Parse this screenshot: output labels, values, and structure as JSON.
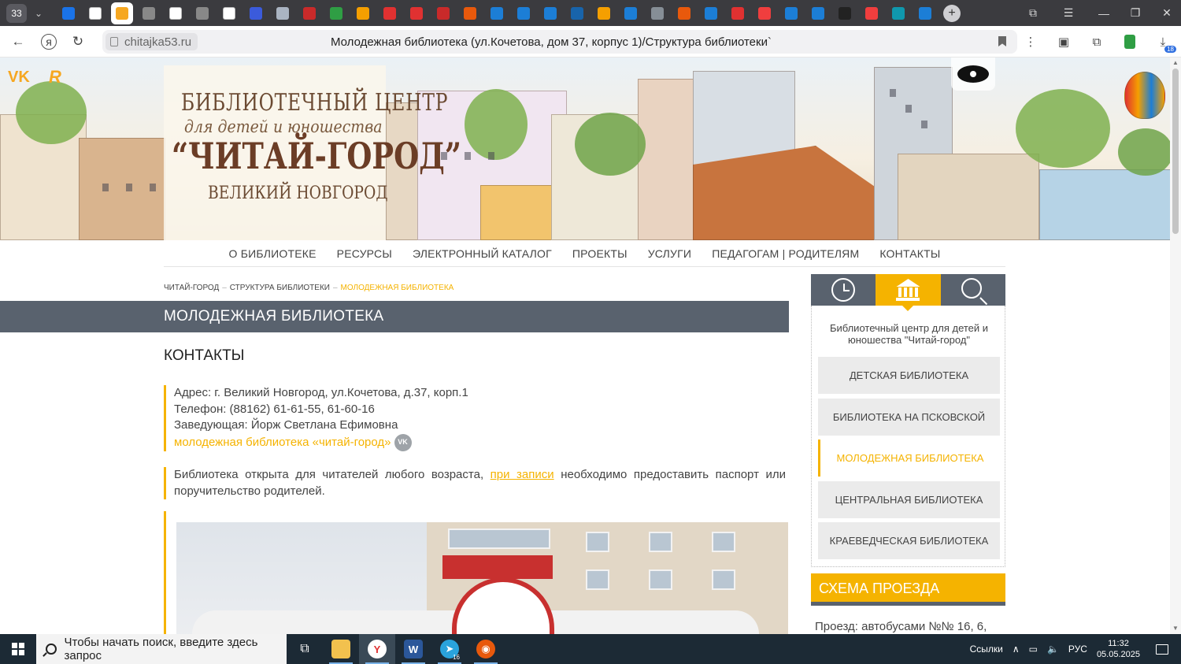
{
  "browser": {
    "tab_count": "33",
    "active_tab_index": 2,
    "tabs": [
      {
        "icon": "yandex-tab-icon",
        "color": "#1a73e8"
      },
      {
        "icon": "document-tab-icon",
        "color": "#ffffff"
      },
      {
        "icon": "library-tab-icon",
        "color": "#f6a721"
      },
      {
        "icon": "gear-tab-icon",
        "color": "#888888"
      },
      {
        "icon": "document-tab-icon",
        "color": "#ffffff"
      },
      {
        "icon": "gear-tab-icon",
        "color": "#888888"
      },
      {
        "icon": "document-tab-icon",
        "color": "#ffffff"
      },
      {
        "icon": "u-tab-icon",
        "color": "#3b5bdb"
      },
      {
        "icon": "grid-tab-icon",
        "color": "#aab4c2"
      },
      {
        "icon": "bug-tab-icon",
        "color": "#c92a2a"
      },
      {
        "icon": "one-tab-icon",
        "color": "#2f9e44"
      },
      {
        "icon": "circle-tab-icon",
        "color": "#f59f00"
      },
      {
        "icon": "heart-tab-icon",
        "color": "#e03131"
      },
      {
        "icon": "heart-tab-icon",
        "color": "#e03131"
      },
      {
        "icon": "red-tab-icon",
        "color": "#c92a2a"
      },
      {
        "icon": "book-tab-icon",
        "color": "#e8590c"
      },
      {
        "icon": "form-tab-icon",
        "color": "#1c7ed6"
      },
      {
        "icon": "form-tab-icon",
        "color": "#1c7ed6"
      },
      {
        "icon": "mail-tab-icon",
        "color": "#1c7ed6"
      },
      {
        "icon": "r-tab-icon",
        "color": "#1864ab"
      },
      {
        "icon": "bolt-tab-icon",
        "color": "#f59f00"
      },
      {
        "icon": "o-tab-icon",
        "color": "#1c7ed6"
      },
      {
        "icon": "news-tab-icon",
        "color": "#868e96"
      },
      {
        "icon": "book-tab-icon",
        "color": "#e8590c"
      },
      {
        "icon": "g-tab-icon",
        "color": "#1c7ed6"
      },
      {
        "icon": "hh-tab-icon",
        "color": "#e03131"
      },
      {
        "icon": "ya-tab-icon",
        "color": "#f03e3e"
      },
      {
        "icon": "chat-tab-icon",
        "color": "#1c7ed6"
      },
      {
        "icon": "vk-tab-icon",
        "color": "#1c7ed6"
      },
      {
        "icon": "plus-tab-icon",
        "color": "#222222"
      },
      {
        "icon": "ya-tab-icon",
        "color": "#f03e3e"
      },
      {
        "icon": "b-tab-icon",
        "color": "#1098ad"
      },
      {
        "icon": "cap-tab-icon",
        "color": "#1c7ed6"
      }
    ],
    "domain": "chitajka53.ru",
    "page_title": "Молодежная библиотека (ул.Кочетова, дом 37, корпус 1)/Структура библиотеки`",
    "downloads_badge": "18"
  },
  "site": {
    "logo": {
      "line1": "БИБЛИОТЕЧНЫЙ ЦЕНТР",
      "line2": "для детей и юношества",
      "line3": "“ЧИТАЙ-ГОРОД”",
      "line4": "ВЕЛИКИЙ НОВГОРОД"
    },
    "social": {
      "vk": "VK",
      "r": "R"
    },
    "menu": [
      "О библиотеке",
      "Ресурсы",
      "Электронный каталог",
      "Проекты",
      "Услуги",
      "Педагогам | Родителям",
      "Контакты"
    ],
    "breadcrumb": {
      "home": "ЧИТАЙ-ГОРОД",
      "sep": "–",
      "section": "СТРУКТУРА БИБЛИОТЕКИ",
      "current": "МОЛОДЕЖНАЯ БИБЛИОТЕКА"
    },
    "page_heading": "Молодежная библиотека",
    "contacts_heading": "КОНТАКТЫ",
    "contacts": {
      "address": "Адрес: г. Великий Новгород,  ул.Кочетова, д.37, корп.1",
      "phone": "Телефон: (88162) 61-61-55, 61-60-16",
      "manager": "Заведующая:  Йорж Светлана Ефимовна",
      "vk_link": "молодежная библиотека «читай-город»",
      "vk_badge": "VK"
    },
    "notice": {
      "before": "Библиотека открыта для читателей любого возраста, ",
      "link": "при записи",
      "after": " необходимо предоставить паспорт или поручительство родителей."
    },
    "sidebar": {
      "org_name": "Библиотечный центр для детей и юношества \"Читай-город\"",
      "items": [
        {
          "label": "ДЕТСКАЯ БИБЛИОТЕКА",
          "active": false
        },
        {
          "label": "БИБЛИОТЕКА НА ПСКОВСКОЙ",
          "active": false
        },
        {
          "label": "МОЛОДЕЖНАЯ БИБЛИОТЕКА",
          "active": true
        },
        {
          "label": "ЦЕНТРАЛЬНАЯ БИБЛИОТЕКА",
          "active": false
        },
        {
          "label": "КРАЕВЕДЧЕСКАЯ БИБЛИОТЕКА",
          "active": false
        }
      ],
      "route_heading": "СХЕМА ПРОЕЗДА",
      "route_text": "Проезд: автобусами №№ 16, 6,"
    },
    "colors": {
      "accent": "#f5b300",
      "bar": "#59626e"
    }
  },
  "taskbar": {
    "search_placeholder": "Чтобы начать поиск, введите здесь запрос",
    "links_label": "Ссылки",
    "lang": "РУС",
    "time": "11:32",
    "date": "05.05.2025",
    "telegram_badge": "16"
  }
}
